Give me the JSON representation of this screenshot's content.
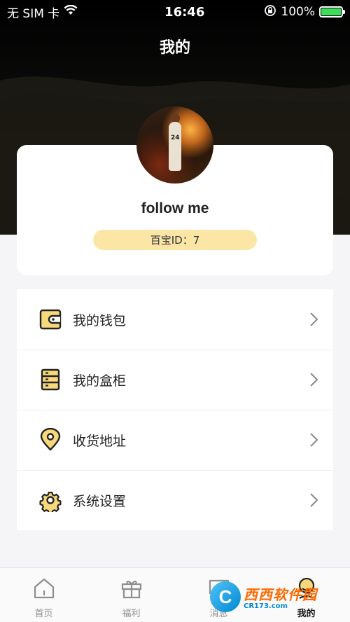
{
  "status_bar": {
    "carrier": "无 SIM 卡",
    "time": "16:46",
    "battery_percent": "100%",
    "battery_color": "#3ddc5a"
  },
  "header": {
    "title": "我的"
  },
  "profile": {
    "avatar_text": "24",
    "username": "follow me",
    "id_label": "百宝ID：7"
  },
  "menu": {
    "items": [
      {
        "label": "我的钱包",
        "icon": "wallet-icon"
      },
      {
        "label": "我的盒柜",
        "icon": "cabinet-icon"
      },
      {
        "label": "收货地址",
        "icon": "location-pin-icon"
      },
      {
        "label": "系统设置",
        "icon": "gear-icon"
      }
    ]
  },
  "tabbar": {
    "tabs": [
      {
        "label": "首页",
        "icon": "home-icon",
        "active": false
      },
      {
        "label": "福利",
        "icon": "gift-icon",
        "active": false
      },
      {
        "label": "消息",
        "icon": "message-icon",
        "active": false
      },
      {
        "label": "我的",
        "icon": "profile-icon",
        "active": true
      }
    ]
  },
  "watermark": {
    "logo_letter": "C",
    "main": "西西软件园",
    "sub": "CR173.com"
  },
  "colors": {
    "accent": "#fbe6a6",
    "icon_fill": "#f7d87a",
    "header_bg": "#000000"
  }
}
